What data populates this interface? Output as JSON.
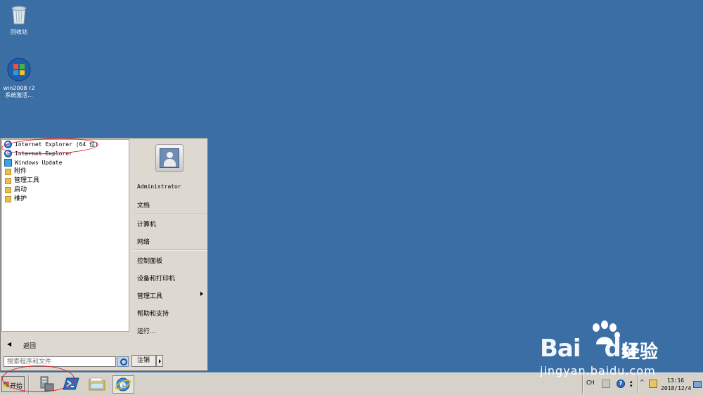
{
  "desktop": {
    "icons": [
      {
        "label": "回收站",
        "icon": "recycle-bin-icon"
      },
      {
        "label": "win2008 r2\n系统激活...",
        "icon": "windows-logo-icon"
      }
    ]
  },
  "start_menu": {
    "programs": [
      {
        "label": "Internet Explorer (64 位)",
        "icon": "ie-icon"
      },
      {
        "label": "Internet Explorer",
        "icon": "ie-icon"
      },
      {
        "label": "Windows Update",
        "icon": "windows-update-icon"
      },
      {
        "label": "附件",
        "icon": "folder-icon"
      },
      {
        "label": "管理工具",
        "icon": "folder-icon"
      },
      {
        "label": "启动",
        "icon": "folder-icon"
      },
      {
        "label": "维护",
        "icon": "folder-icon"
      }
    ],
    "back_label": "返回",
    "search_placeholder": "搜索程序和文件",
    "right": {
      "user": "Administrator",
      "documents": "文档",
      "computer": "计算机",
      "network": "网络",
      "control_panel": "控制面板",
      "devices_printers": "设备和打印机",
      "admin_tools": "管理工具",
      "help_support": "帮助和支持",
      "run": "运行..."
    },
    "logoff_label": "注销"
  },
  "taskbar": {
    "start_label": "开始",
    "pinned": [
      "server-manager-icon",
      "powershell-icon",
      "explorer-icon",
      "ie-icon"
    ],
    "tray": {
      "language": "CH",
      "time": "13:16",
      "date": "2018/12/4"
    }
  },
  "watermark": {
    "brand": "Bai",
    "brand2": "du",
    "cn": "经验",
    "url": "jingyan.baidu.com"
  },
  "colors": {
    "desktop": "#3a6ea5",
    "annotation": "#e0192a"
  }
}
